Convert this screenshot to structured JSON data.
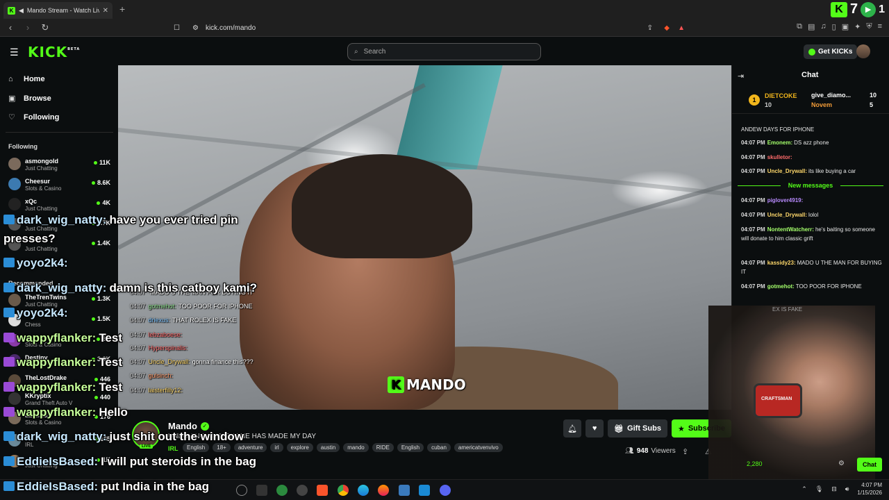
{
  "browser": {
    "tab_title": "Mando Stream - Watch Live o",
    "tab_close": "✕",
    "new_tab": "+",
    "url": "kick.com/mando",
    "top_right_count": "7",
    "top_right_extra": "1"
  },
  "header": {
    "logo": "KICK",
    "logo_sup": "BETA",
    "search_placeholder": "Search",
    "get_kicks": "Get KICKs"
  },
  "sidebar": {
    "nav": [
      {
        "label": "Home",
        "icon": "home-icon"
      },
      {
        "label": "Browse",
        "icon": "browse-icon"
      },
      {
        "label": "Following",
        "icon": "heart-icon"
      }
    ],
    "following_heading": "Following",
    "recommended_heading": "Recommended",
    "following": [
      {
        "name": "asmongold",
        "category": "Just Chatting",
        "viewers": "11K"
      },
      {
        "name": "Cheesur",
        "category": "Slots & Casino",
        "viewers": "8.6K"
      },
      {
        "name": "xQc",
        "category": "Just Chatting",
        "viewers": "4K"
      },
      {
        "name": "",
        "category": "Just Chatting",
        "viewers": "1.7K"
      },
      {
        "name": "",
        "category": "Just Chatting",
        "viewers": "1.4K"
      }
    ],
    "recommended": [
      {
        "name": "TheTrenTwins",
        "category": "Just Chatting",
        "viewers": "1.3K"
      },
      {
        "name": "",
        "category": "Chess",
        "viewers": "1.5K"
      },
      {
        "name": "",
        "category": "Slots & Casino",
        "viewers": "3K"
      },
      {
        "name": "Destiny",
        "category": "",
        "viewers": "3.8K"
      },
      {
        "name": "TheLostDrake",
        "category": "",
        "viewers": "446"
      },
      {
        "name": "KKryptix",
        "category": "Grand Theft Auto V",
        "viewers": "440"
      },
      {
        "name": "adinross",
        "category": "Slots & Casino",
        "viewers": "176"
      },
      {
        "name": "",
        "category": "IRL",
        "viewers": "165"
      },
      {
        "name": "",
        "category": "Just Chatting",
        "viewers": "1K"
      }
    ]
  },
  "video": {
    "watermark": "MANDO",
    "overlay_chat": [
      {
        "time": "04:07",
        "user": "",
        "text": "MADO U THE MAN FOR BUYING IT",
        "color": "#cccccc"
      },
      {
        "time": "04:07",
        "user": "gotmehot:",
        "text": "TOO POOR FOR IPHONE",
        "color": "#8fe08f"
      },
      {
        "time": "04:07",
        "user": "driexus:",
        "text": "THAT ROLEX IS FAKE",
        "color": "#7ec4ff"
      },
      {
        "time": "04:07",
        "user": "lebzaboese:",
        "text": "",
        "color": "#ff6b6b"
      },
      {
        "time": "04:07",
        "user": "Hyperspinalis:",
        "text": "",
        "color": "#ff6b6b"
      },
      {
        "time": "04:07",
        "user": "Uncle_Drywall:",
        "text": "gonna finance this???",
        "color": "#ffd86b"
      },
      {
        "time": "04:07",
        "user": "gulsinch:",
        "text": "",
        "color": "#ff9b6b"
      },
      {
        "time": "04:07",
        "user": "laisterfilly12:",
        "text": "",
        "color": "#ffd86b"
      }
    ]
  },
  "stream_info": {
    "name": "Mando",
    "title": "UNBOXING NEW PHONE HAS MADE MY DAY",
    "category": "IRL",
    "tags": [
      "English",
      "18+",
      "adventure",
      "irl",
      "explore",
      "austin",
      "mando",
      "RIDE",
      "English",
      "cuban",
      "americatvenvivo"
    ],
    "viewers": "948",
    "viewers_label": "Viewers",
    "gift_subs": "Gift Subs",
    "subscribe": "Subscribe",
    "live": "LIVE"
  },
  "chat": {
    "title": "Chat",
    "pinned": {
      "rank": "1",
      "user1": "DIETCOKE",
      "user1_count": "10",
      "user2": "give_diamo...",
      "user2_count": "10",
      "user3": "Novem",
      "user3_count": "5"
    },
    "messages": [
      {
        "time": "",
        "user": "",
        "text": "ANDEW DAYS FOR IPHONE",
        "user_color": "#ffffff"
      },
      {
        "time": "04:07 PM",
        "user": "Emonem:",
        "text": "DS azz phone",
        "user_color": "#a4ff6b"
      },
      {
        "time": "04:07 PM",
        "user": "skulletor:",
        "text": "",
        "user_color": "#ff6b6b"
      },
      {
        "time": "04:07 PM",
        "user": "Uncle_Drywall:",
        "text": "its like buying a car",
        "user_color": "#ffd86b"
      }
    ],
    "new_messages": "New messages",
    "messages2": [
      {
        "time": "04:07 PM",
        "user": "piglover4919:",
        "text": "",
        "user_color": "#b98bff"
      },
      {
        "time": "04:07 PM",
        "user": "Uncle_Drywall:",
        "text": "lolol",
        "user_color": "#ffd86b"
      },
      {
        "time": "04:07 PM",
        "user": "NontentWatcherr:",
        "text": "he's baiting so someone will donate to him",
        "extra": "classic grift",
        "user_color": "#a4ff6b"
      },
      {
        "time": "04:07 PM",
        "user": "kassidy23:",
        "text": "MADO U THE MAN FOR BUYING IT",
        "user_color": "#ffd86b"
      },
      {
        "time": "04:07 PM",
        "user": "gotmehot:",
        "text": "TOO POOR FOR IPHONE",
        "user_color": "#a4ff6b"
      },
      {
        "time": "04:07 PM",
        "user": "",
        "text": "EX IS FAKE",
        "user_color": "#ffffff"
      }
    ],
    "input_count": "2,280",
    "send": "Chat"
  },
  "tts_overlay": [
    {
      "user": "dark_wig_natty:",
      "text": "have you ever tried pin",
      "color": "#c6e8ff"
    },
    {
      "user": "",
      "text": "presses?",
      "color": "#ffffff"
    },
    {
      "user": "yoyo2k4:",
      "text": "",
      "color": "#c6e8ff"
    },
    {
      "user": "dark_wig_natty:",
      "text": "damn is this catboy kami?",
      "color": "#c6e8ff"
    },
    {
      "user": "yoyo2k4:",
      "text": "",
      "color": "#c6e8ff"
    },
    {
      "user": "wappyflanker:",
      "text": "Test",
      "color": "#c6ff9a"
    },
    {
      "user": "wappyflanker:",
      "text": "Test",
      "color": "#c6ff9a"
    },
    {
      "user": "wappyflanker:",
      "text": "Test",
      "color": "#c6ff9a"
    },
    {
      "user": "wappyflanker:",
      "text": "Hello",
      "color": "#c6ff9a"
    },
    {
      "user": "dark_wig_natty:",
      "text": "just shit out the window",
      "color": "#c6e8ff"
    },
    {
      "user": "EddieIsBased:",
      "text": "I will put steroids in the bag",
      "color": "#c6e8ff"
    },
    {
      "user": "EddieIsBased:",
      "text": "put India in the bag",
      "color": "#c6e8ff"
    }
  ],
  "taskbar": {
    "time": "4:07 PM",
    "date": "1/15/2026"
  },
  "colors": {
    "accent": "#53fc18",
    "background": "#0b0e0f",
    "surface": "#2a2e31"
  }
}
